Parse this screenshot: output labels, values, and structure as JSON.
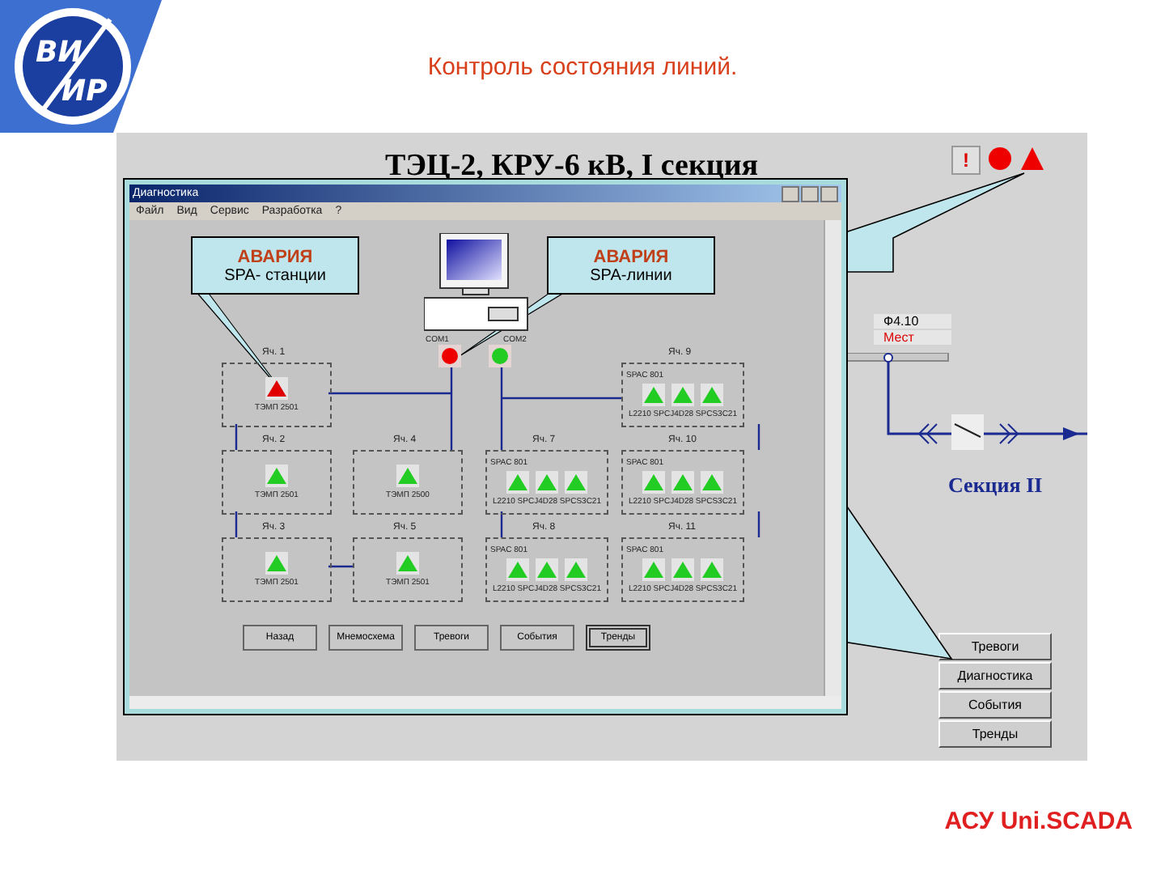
{
  "slide": {
    "logo": {
      "top": "ВИ",
      "bottom": "ИР"
    },
    "title": "Контроль состояния линий.",
    "footer": "АСУ Uni.SCADA"
  },
  "screen": {
    "title": "ТЭЦ-2, КРУ-6 кВ, I секция",
    "status_icons": [
      {
        "kind": "exclamation",
        "label": "!"
      },
      {
        "kind": "circle"
      },
      {
        "kind": "triangle"
      }
    ],
    "feeder": {
      "name": "Ф4.10",
      "mode": "Мест"
    },
    "section_label": "Секция II",
    "nav_buttons": [
      "Тревоги",
      "Диагностика",
      "События",
      "Тренды"
    ]
  },
  "window": {
    "title": "Диагностика",
    "menu": [
      "Файл",
      "Вид",
      "Сервис",
      "Разработка",
      "?"
    ],
    "callouts": [
      {
        "heading": "АВАРИЯ",
        "text": "SPA- станции"
      },
      {
        "heading": "АВАРИЯ",
        "text": "SPA-линии"
      }
    ],
    "ports": [
      {
        "label": "COM1",
        "alarm": true
      },
      {
        "label": "COM2",
        "alarm": false
      }
    ],
    "cells": [
      {
        "label": "Яч. 1",
        "kind": "single",
        "device": "ТЭМП 2501",
        "indicators": [
          {
            "alarm": true
          }
        ]
      },
      {
        "label": "Яч. 2",
        "kind": "single",
        "device": "ТЭМП 2501",
        "indicators": [
          {
            "alarm": false
          }
        ]
      },
      {
        "label": "Яч. 3",
        "kind": "single",
        "device": "ТЭМП 2501",
        "indicators": [
          {
            "alarm": false
          }
        ]
      },
      {
        "label": "Яч. 4",
        "kind": "single",
        "device": "ТЭМП 2500",
        "indicators": [
          {
            "alarm": false
          }
        ]
      },
      {
        "label": "Яч. 5",
        "kind": "single",
        "device": "ТЭМП 2501",
        "indicators": [
          {
            "alarm": false
          }
        ]
      },
      {
        "label": "Яч. 7",
        "kind": "spa",
        "device": "SPAC 801",
        "modules": "L2210 SPCJ4D28 SPCS3C21",
        "indicators": [
          {
            "alarm": false
          },
          {
            "alarm": false
          },
          {
            "alarm": false
          }
        ]
      },
      {
        "label": "Яч. 8",
        "kind": "spa",
        "device": "SPAC 801",
        "modules": "L2210 SPCJ4D28 SPCS3C21",
        "indicators": [
          {
            "alarm": false
          },
          {
            "alarm": false
          },
          {
            "alarm": false
          }
        ]
      },
      {
        "label": "Яч. 9",
        "kind": "spa",
        "device": "SPAC 801",
        "modules": "L2210 SPCJ4D28 SPCS3C21",
        "indicators": [
          {
            "alarm": false
          },
          {
            "alarm": false
          },
          {
            "alarm": false
          }
        ]
      },
      {
        "label": "Яч. 10",
        "kind": "spa",
        "device": "SPAC 801",
        "modules": "L2210 SPCJ4D28 SPCS3C21",
        "indicators": [
          {
            "alarm": false
          },
          {
            "alarm": false
          },
          {
            "alarm": false
          }
        ]
      },
      {
        "label": "Яч. 11",
        "kind": "spa",
        "device": "SPAC 801",
        "modules": "L2210 SPCJ4D28 SPCS3C21",
        "indicators": [
          {
            "alarm": false
          },
          {
            "alarm": false
          },
          {
            "alarm": false
          }
        ]
      }
    ],
    "buttons": [
      {
        "label": "Назад",
        "pressed": false
      },
      {
        "label": "Мнемосхема",
        "pressed": false
      },
      {
        "label": "Тревоги",
        "pressed": false
      },
      {
        "label": "События",
        "pressed": false
      },
      {
        "label": "Тренды",
        "pressed": true
      }
    ]
  }
}
